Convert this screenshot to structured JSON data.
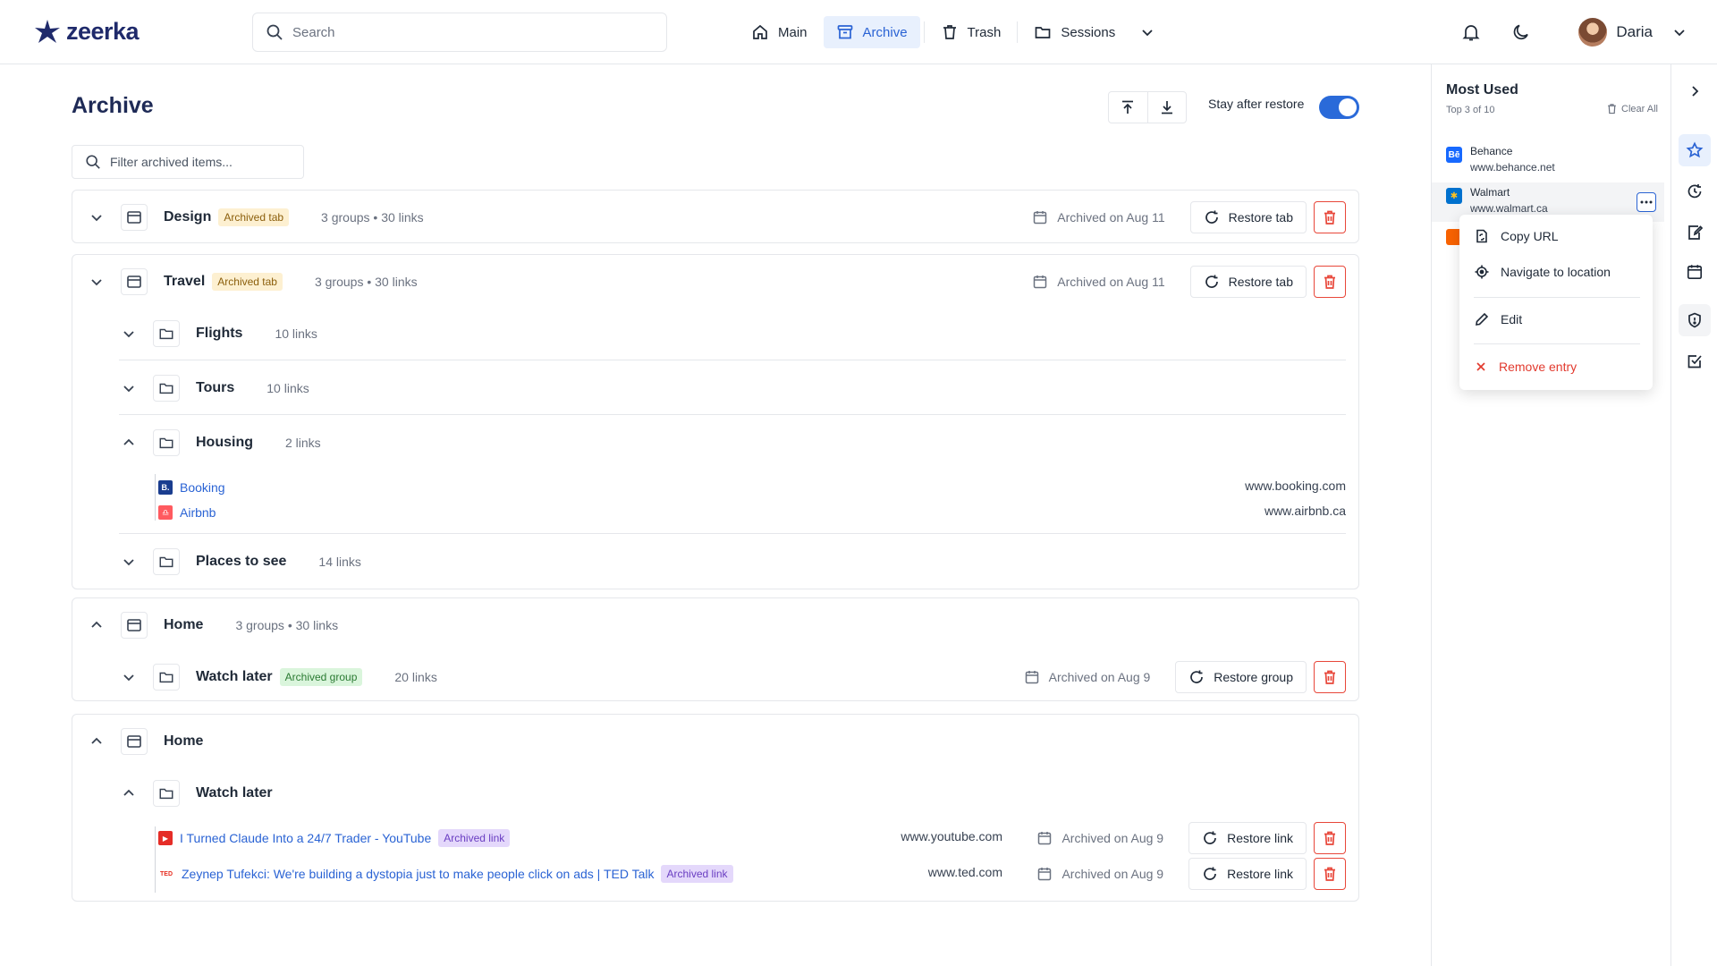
{
  "app": {
    "logo_text": "zeerka"
  },
  "header": {
    "search_placeholder": "Search",
    "nav": [
      {
        "label": "Main",
        "icon": "home-icon"
      },
      {
        "label": "Archive",
        "icon": "archive-icon",
        "active": true
      },
      {
        "label": "Trash",
        "icon": "trash-icon"
      },
      {
        "label": "Sessions",
        "icon": "folder-icon"
      }
    ],
    "user_name": "Daria"
  },
  "page": {
    "title": "Archive",
    "stay_label": "Stay after restore",
    "stay_enabled": true,
    "filter_placeholder": "Filter archived items..."
  },
  "cards": {
    "design": {
      "title": "Design",
      "badge": "Archived tab",
      "meta": "3 groups • 30 links",
      "archived_on": "Archived on Aug 11",
      "restore": "Restore tab"
    },
    "travel": {
      "title": "Travel",
      "badge": "Archived tab",
      "meta": "3 groups • 30 links",
      "archived_on": "Archived on Aug 11",
      "restore": "Restore tab",
      "groups": [
        {
          "title": "Flights",
          "meta": "10 links"
        },
        {
          "title": "Tours",
          "meta": "10 links"
        },
        {
          "title": "Housing",
          "meta": "2 links",
          "links": [
            {
              "title": "Booking",
              "url": "www.booking.com",
              "favicon": "B."
            },
            {
              "title": "Airbnb",
              "url": "www.airbnb.ca",
              "favicon": "♎"
            }
          ]
        },
        {
          "title": "Places to see",
          "meta": "14 links"
        }
      ]
    },
    "home1": {
      "title": "Home",
      "meta": "3 groups • 30 links",
      "group": {
        "title": "Watch later",
        "badge": "Archived group",
        "meta": "20 links",
        "archived_on": "Archived on Aug 9",
        "restore": "Restore group"
      }
    },
    "home2": {
      "title": "Home",
      "group_title": "Watch later",
      "links": [
        {
          "title": "I Turned Claude Into a 24/7 Trader - YouTube",
          "badge": "Archived link",
          "url": "www.youtube.com",
          "archived_on": "Archived on Aug 9",
          "restore": "Restore link",
          "favicon": "▶"
        },
        {
          "title": "Zeynep Tufekci: We're building a dystopia just to make people click on ads | TED Talk",
          "badge": "Archived link",
          "url": "www.ted.com",
          "archived_on": "Archived on Aug 9",
          "restore": "Restore link",
          "favicon": "TED"
        }
      ]
    }
  },
  "panel": {
    "title": "Most Used",
    "subtitle": "Top 3 of 10",
    "clear_all": "Clear All",
    "items": [
      {
        "name": "Behance",
        "url": "www.behance.net",
        "favicon": "Bē"
      },
      {
        "name": "Walmart",
        "url": "www.walmart.ca",
        "favicon": "✱"
      }
    ],
    "menu": [
      {
        "label": "Copy URL",
        "icon": "copy-icon"
      },
      {
        "label": "Navigate to location",
        "icon": "locate-icon"
      },
      {
        "label": "Edit",
        "icon": "pencil-icon"
      },
      {
        "label": "Remove entry",
        "icon": "close-icon"
      }
    ]
  },
  "colors": {
    "accent": "#2a63d4",
    "danger": "#e23a2e",
    "title": "#1e2a56"
  }
}
